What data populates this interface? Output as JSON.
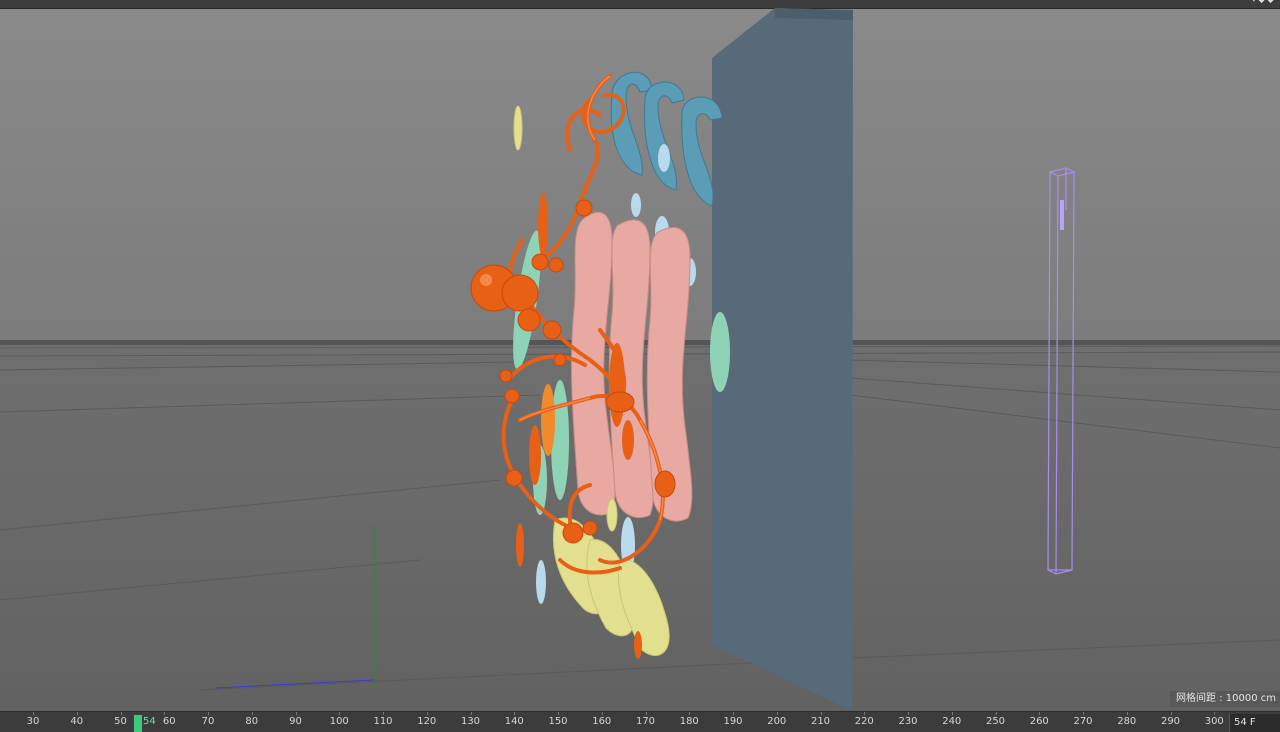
{
  "menu": {
    "items": [
      "",
      "",
      "",
      ""
    ],
    "active_label": "",
    "window_controls": "▾◆◆"
  },
  "viewport": {
    "grid_spacing_label": "网格间距 : 10000 cm",
    "scene": {
      "colors": {
        "orange": "#e85f16",
        "pink": "#e7a9a1",
        "blue_curl": "#5b9cb6",
        "light_blue": "#b9d9ec",
        "mint": "#8fd3b6",
        "yellow": "#e2e08f",
        "panel": "#566a79",
        "wireframe": "#a88df0"
      }
    }
  },
  "timeline": {
    "ticks": [
      "30",
      "40",
      "50",
      "60",
      "70",
      "80",
      "90",
      "100",
      "110",
      "120",
      "130",
      "140",
      "150",
      "160",
      "170",
      "180",
      "190",
      "200",
      "210",
      "220",
      "230",
      "240",
      "250",
      "260",
      "270",
      "280",
      "290",
      "300"
    ],
    "current_frame": "54",
    "frame_field": "54 F"
  }
}
